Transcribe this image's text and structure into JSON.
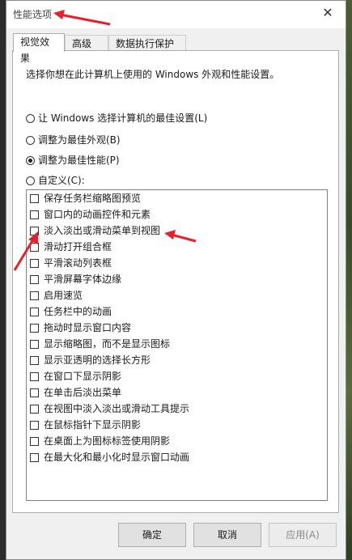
{
  "window": {
    "title": "性能选项",
    "close_glyph": "✕"
  },
  "tabs": [
    {
      "label": "视觉效果",
      "active": true
    },
    {
      "label": "高级",
      "active": false
    },
    {
      "label": "数据执行保护",
      "active": false
    }
  ],
  "description": "选择你想在此计算机上使用的 Windows 外观和性能设置。",
  "radios": [
    {
      "label": "让 Windows 选择计算机的最佳设置(L)",
      "checked": false
    },
    {
      "label": "调整为最佳外观(B)",
      "checked": false
    },
    {
      "label": "调整为最佳性能(P)",
      "checked": true
    },
    {
      "label": "自定义(C):",
      "checked": false
    }
  ],
  "checklist": [
    {
      "label": "保存任务栏缩略图预览",
      "checked": false
    },
    {
      "label": "窗口内的动画控件和元素",
      "checked": false
    },
    {
      "label": "淡入淡出或滑动菜单到视图",
      "checked": false
    },
    {
      "label": "滑动打开组合框",
      "checked": false
    },
    {
      "label": "平滑滚动列表框",
      "checked": false
    },
    {
      "label": "平滑屏幕字体边缘",
      "checked": false
    },
    {
      "label": "启用速览",
      "checked": false
    },
    {
      "label": "任务栏中的动画",
      "checked": false
    },
    {
      "label": "拖动时显示窗口内容",
      "checked": false
    },
    {
      "label": "显示缩略图，而不是显示图标",
      "checked": false
    },
    {
      "label": "显示亚透明的选择长方形",
      "checked": false
    },
    {
      "label": "在窗口下显示阴影",
      "checked": false
    },
    {
      "label": "在单击后淡出菜单",
      "checked": false
    },
    {
      "label": "在视图中淡入淡出或滑动工具提示",
      "checked": false
    },
    {
      "label": "在鼠标指针下显示阴影",
      "checked": false
    },
    {
      "label": "在桌面上为图标标签使用阴影",
      "checked": false
    },
    {
      "label": "在最大化和最小化时显示窗口动画",
      "checked": false
    }
  ],
  "buttons": {
    "ok": "确定",
    "cancel": "取消",
    "apply": "应用(A)"
  },
  "colors": {
    "annotation_arrow": "#e8202a",
    "window_bg": "#f0f0f0"
  }
}
